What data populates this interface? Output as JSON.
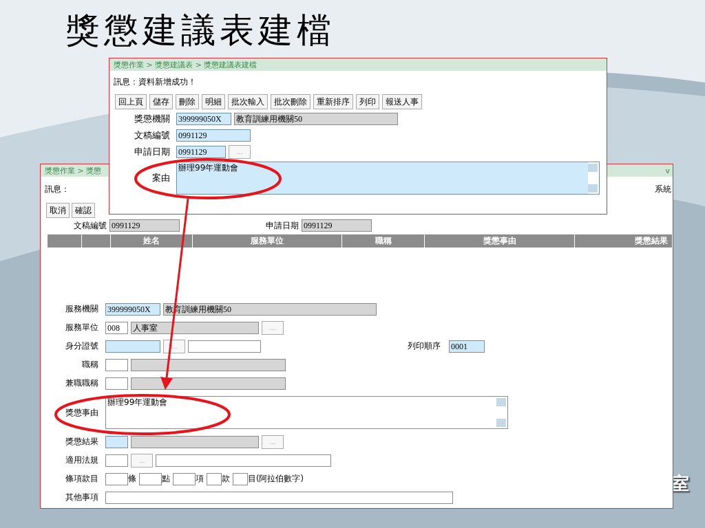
{
  "slide": {
    "title": "獎懲建議表建檔",
    "corner_text": "室"
  },
  "back_window": {
    "breadcrumb": "獎懲作業 > 獎懲",
    "corner_mark": "v",
    "message_label": "訊息：",
    "system_text": "系統",
    "buttons": [
      "取消",
      "確認"
    ],
    "header_fields": [
      {
        "label": "文稿編號",
        "value": "0991129"
      },
      {
        "label": "申請日期",
        "value": "0991129"
      }
    ],
    "table": {
      "columns": [
        "姓名",
        "服務單位",
        "職稱",
        "獎懲事由",
        "獎懲結果"
      ]
    },
    "form": [
      {
        "label": "服務機關",
        "parts": [
          {
            "kind": "code",
            "required": true,
            "readonly": false,
            "value": "399999050X"
          },
          {
            "kind": "org",
            "required": false,
            "readonly": true,
            "value": "教育訓練用機關50"
          }
        ]
      },
      {
        "label": "服務單位",
        "parts": [
          {
            "kind": "short",
            "required": false,
            "readonly": false,
            "value": "008"
          },
          {
            "kind": "name",
            "required": false,
            "readonly": true,
            "value": "人事室"
          },
          {
            "kind": "lookup",
            "value": "..."
          }
        ]
      },
      {
        "label": "身分證號",
        "parts": [
          {
            "kind": "code",
            "required": true,
            "readonly": false
          },
          {
            "kind": "lookup",
            "value": "..."
          },
          {
            "kind": "id",
            "required": false,
            "readonly": false
          }
        ],
        "extra": {
          "label": "列印順序",
          "value": "0001"
        }
      },
      {
        "label": "職稱",
        "parts": [
          {
            "kind": "short",
            "required": false,
            "readonly": false
          },
          {
            "kind": "title",
            "required": false,
            "readonly": true
          }
        ]
      },
      {
        "label": "兼職職稱",
        "parts": [
          {
            "kind": "short",
            "required": false,
            "readonly": false
          },
          {
            "kind": "title",
            "required": false,
            "readonly": true
          }
        ]
      },
      {
        "label": "獎懲事由",
        "parts": [
          {
            "kind": "textarea",
            "required": false,
            "readonly": false,
            "value": "辦理99年運動會"
          }
        ]
      },
      {
        "label": "獎懲結果",
        "parts": [
          {
            "kind": "short",
            "required": true,
            "readonly": false
          },
          {
            "kind": "name",
            "required": false,
            "readonly": true
          },
          {
            "kind": "lookup",
            "value": "..."
          }
        ]
      },
      {
        "label": "適用法規",
        "parts": [
          {
            "kind": "short",
            "required": false,
            "readonly": false
          },
          {
            "kind": "lookup",
            "value": "..."
          },
          {
            "kind": "law",
            "required": false,
            "readonly": false
          }
        ]
      },
      {
        "label": "條項款目",
        "parts": [
          {
            "kind": "tiny",
            "required": false,
            "readonly": false
          },
          {
            "kind": "text",
            "value": "條"
          },
          {
            "kind": "tiny",
            "required": false,
            "readonly": false
          },
          {
            "kind": "text",
            "value": "點"
          },
          {
            "kind": "tiny",
            "required": false,
            "readonly": false
          },
          {
            "kind": "text",
            "value": "項"
          },
          {
            "kind": "mini",
            "required": false,
            "readonly": false
          },
          {
            "kind": "text",
            "value": "款"
          },
          {
            "kind": "mini",
            "required": false,
            "readonly": false
          },
          {
            "kind": "text",
            "value": "目(阿拉伯數字)"
          }
        ]
      },
      {
        "label": "其他事項",
        "parts": [
          {
            "kind": "other",
            "required": false,
            "readonly": false
          }
        ]
      }
    ]
  },
  "front_window": {
    "breadcrumb": "獎懲作業 > 獎懲建議表 > 獎懲建議表建檔",
    "message": "訊息：資料新增成功！",
    "buttons": [
      "回上頁",
      "儲存",
      "刪除",
      "明細",
      "批次輸入",
      "批次刪除",
      "重新排序",
      "列印",
      "報送人事"
    ],
    "form": [
      {
        "label": "獎懲機關",
        "parts": [
          {
            "kind": "code",
            "required": true,
            "readonly": false,
            "value": "399999050X"
          },
          {
            "kind": "fname",
            "required": false,
            "readonly": true,
            "value": "教育訓練用機關50"
          }
        ]
      },
      {
        "label": "文稿編號",
        "parts": [
          {
            "kind": "doc",
            "required": true,
            "readonly": false,
            "value": "0991129"
          }
        ]
      },
      {
        "label": "申請日期",
        "parts": [
          {
            "kind": "date",
            "required": true,
            "readonly": false,
            "value": "0991129"
          },
          {
            "kind": "lookup",
            "value": "..."
          }
        ]
      },
      {
        "label": "案由",
        "parts": [
          {
            "kind": "ftextarea",
            "required": true,
            "readonly": false,
            "value": "辦理99年運動會"
          }
        ]
      }
    ]
  }
}
